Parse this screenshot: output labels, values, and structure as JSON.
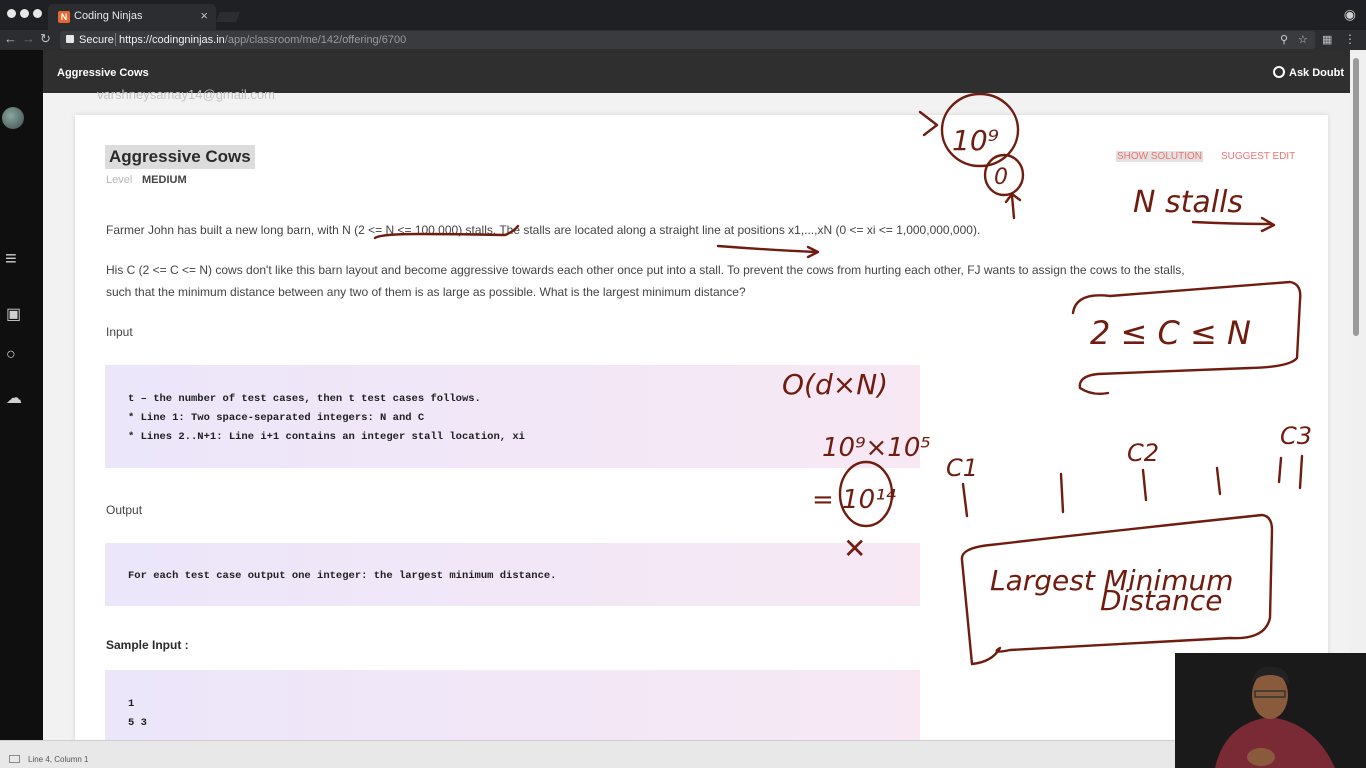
{
  "browser": {
    "tab_title": "Coding Ninjas",
    "tab_close": "×",
    "secure_label": "Secure",
    "url_host": "https://codingninjas.in",
    "url_path": "/app/classroom/me/142/offering/6700"
  },
  "app": {
    "header_title": "Aggressive Cows",
    "ask_doubt_label": "Ask Doubt",
    "ghost_email": "varshneysamay14@gmail.com"
  },
  "problem": {
    "title": "Aggressive Cows",
    "level_label": "Level",
    "level_value": "MEDIUM",
    "show_solution_label": "SHOW SOLUTION",
    "suggest_edit_label": "SUGGEST EDIT",
    "paragraph1": "Farmer John has built a new long barn, with N (2 <= N <= 100,000) stalls. The stalls are located along a straight line at positions x1,...,xN (0 <= xi <= 1,000,000,000).",
    "paragraph2_line1": "His C (2 <= C <= N) cows don't like this barn layout and become aggressive towards each other once put into a stall. To prevent the cows from hurting each other, FJ wants to assign the cows to the stalls,",
    "paragraph2_line2": "such that the minimum distance between any two of them is as large as possible. What is the largest minimum distance?",
    "input_label": "Input",
    "input_lines": [
      "t – the number of test cases, then t test cases follows.",
      "* Line 1: Two space-separated integers: N and C",
      "* Lines 2..N+1: Line i+1 contains an integer stall location, xi"
    ],
    "output_label": "Output",
    "output_line": "For each test case output one integer: the largest minimum distance.",
    "sample_input_label": "Sample Input :",
    "sample_input_lines": [
      "1",
      "5 3"
    ]
  },
  "status_bar": {
    "text": "Line 4, Column 1"
  },
  "annotations": {
    "ten_pow_9": "10⁹",
    "zero": "0",
    "n_stalls": "N stalls",
    "constraint": "2 ≤ C ≤ N",
    "complexity": "O(d×N)",
    "product": "10⁹×10⁵",
    "result": "= 10¹⁴",
    "cross": "✕",
    "c1": "C1",
    "c2": "C2",
    "c3": "C3",
    "largest_min_line1": "Largest Minimum",
    "largest_min_line2": "Distance"
  },
  "colors": {
    "ink": "#701d10",
    "accent_link": "#f07272",
    "header_bg": "#2f2f30"
  }
}
